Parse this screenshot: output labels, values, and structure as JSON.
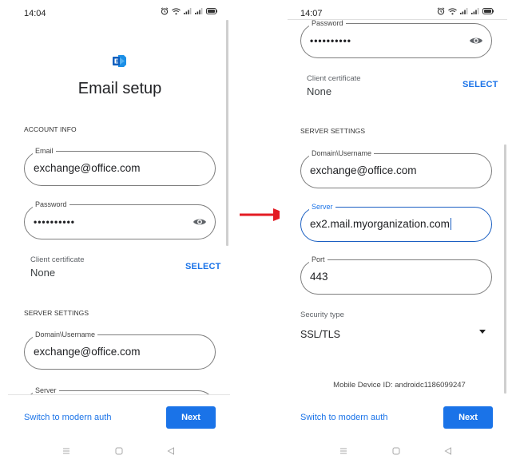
{
  "annotation": {
    "arrow_color": "#e31b23"
  },
  "colors": {
    "accent": "#1a73e8",
    "focus_border": "#1a5fc2",
    "logo_blue": "#1b8fe6"
  },
  "left_screen": {
    "status_bar": {
      "time": "14:04",
      "icons": [
        "alarm-icon",
        "wifi-icon",
        "signal-icon",
        "signal-icon",
        "battery-icon"
      ],
      "battery": "97"
    },
    "logo": "exchange-logo-icon",
    "title": "Email setup",
    "account_info": {
      "section_label": "ACCOUNT INFO",
      "email": {
        "label": "Email",
        "value": "exchange@office.com"
      },
      "password": {
        "label": "Password",
        "value": "••••••••••"
      }
    },
    "client_certificate": {
      "label": "Client certificate",
      "value": "None",
      "action": "SELECT"
    },
    "server_settings": {
      "section_label": "SERVER SETTINGS",
      "domain_username": {
        "label": "Domain\\Username",
        "value": "exchange@office.com"
      },
      "server": {
        "label": "Server",
        "value": ""
      }
    },
    "footer": {
      "switch_link": "Switch to modern auth",
      "next_button": "Next"
    }
  },
  "right_screen": {
    "status_bar": {
      "time": "14:07",
      "icons": [
        "alarm-icon",
        "wifi-icon",
        "signal-icon",
        "signal-icon",
        "battery-icon"
      ],
      "battery": "97"
    },
    "password": {
      "label": "Password",
      "value": "••••••••••"
    },
    "client_certificate": {
      "label": "Client certificate",
      "value": "None",
      "action": "SELECT"
    },
    "server_settings": {
      "section_label": "SERVER SETTINGS",
      "domain_username": {
        "label": "Domain\\Username",
        "value": "exchange@office.com"
      },
      "server": {
        "label": "Server",
        "value": "ex2.mail.myorganization.com"
      },
      "port": {
        "label": "Port",
        "value": "443"
      },
      "security_type": {
        "label": "Security type",
        "value": "SSL/TLS"
      }
    },
    "device_id": "Mobile Device ID: androidc1186099247",
    "footer": {
      "switch_link": "Switch to modern auth",
      "next_button": "Next"
    }
  }
}
